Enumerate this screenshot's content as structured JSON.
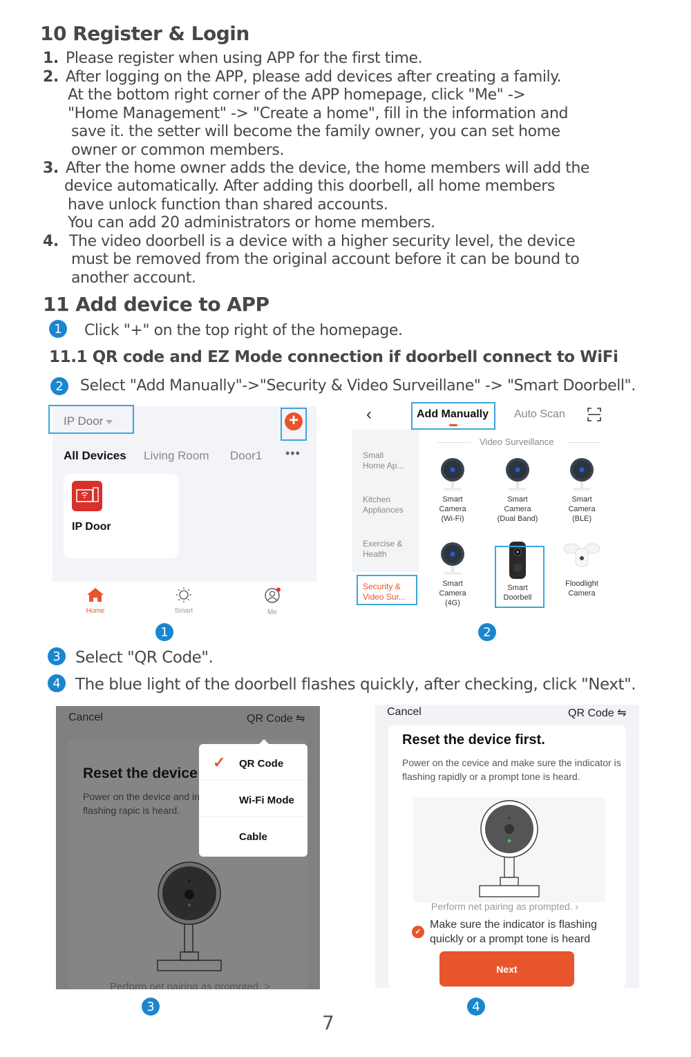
{
  "section10": {
    "title": "10  Register & Login",
    "items": [
      {
        "num": "1.",
        "lines": [
          "Please register when using  APP for the first time."
        ]
      },
      {
        "num": "2.",
        "lines": [
          "After logging on the APP, please add devices after creating a family.",
          "At the bottom right corner of the APP homepage, click \"Me\" ->",
          "\"Home Management\" -> \"Create a home\", fill in the information and",
          "save it. the setter will become the family owner, you can set home",
          "owner or common members."
        ]
      },
      {
        "num": "3.",
        "lines": [
          "After the home owner adds the device, the home members will add the",
          "device automatically. After adding this doorbell, all home members",
          "have unlock function than shared accounts.",
          "You can add 20 administrators or home members."
        ]
      },
      {
        "num": "4.",
        "lines": [
          "The video doorbell is a device with a higher security level, the device",
          "must be removed from the original account before it can be bound to",
          "another account."
        ]
      }
    ]
  },
  "section11": {
    "title": "11  Add device to APP",
    "step1": {
      "badge": "1",
      "text": "Click \"+\" on the top right of the homepage."
    },
    "sub_title": "11.1  QR code and EZ Mode connection if doorbell connect to WiFi",
    "step2": {
      "badge": "2",
      "text": "Select \"Add Manually\"->\"Security & Video Surveillane\" -> \"Smart Doorbell\"."
    },
    "step3": {
      "badge": "3",
      "text": "Select \"QR Code\"."
    },
    "step4": {
      "badge": "4",
      "text": "The blue light of the doorbell flashes quickly, after checking, click \"Next\"."
    }
  },
  "screen1": {
    "home_name": "IP Door",
    "room_tabs": [
      "All Devices",
      "Living Room",
      "Door1"
    ],
    "more": "•••",
    "device_name": "IP Door",
    "tabbar": [
      {
        "label": "Home",
        "icon": "home-icon"
      },
      {
        "label": "Smart",
        "icon": "sun-icon"
      },
      {
        "label": "Me",
        "icon": "user-icon"
      }
    ],
    "caption_badge": "1",
    "accent": "#e8542b"
  },
  "screen2": {
    "back": "‹",
    "tab_active": "Add Manually",
    "tab_other": "Auto Scan",
    "categories": [
      "Small\nHome Ap...",
      "Kitchen\nAppliances",
      "Exercise &\nHealth"
    ],
    "selected_category": "Security &\nVideo Sur...",
    "section_title": "Video Surveillance",
    "products": [
      {
        "name": "Smart\nCamera\n(Wi-Fi)",
        "icon": "camera"
      },
      {
        "name": "Smart\nCamera\n(Dual Band)",
        "icon": "camera"
      },
      {
        "name": "Smart\nCamera\n(BLE)",
        "icon": "camera"
      },
      {
        "name": "Smart\nCamera\n(4G)",
        "icon": "camera"
      },
      {
        "name": "Smart\nDoorbell",
        "icon": "doorbell"
      },
      {
        "name": "Floodlight\nCamera",
        "icon": "floodlight"
      }
    ],
    "caption_badge": "2"
  },
  "screen3": {
    "cancel": "Cancel",
    "mode": "QR Code ⇋",
    "title": "Reset the device",
    "desc": "Power on the device and indicator is flashing rapic is heard.",
    "menu": [
      {
        "label": "QR Code",
        "checked": true
      },
      {
        "label": "Wi-Fi Mode",
        "checked": false
      },
      {
        "label": "Cable",
        "checked": false
      }
    ],
    "footer": "Perform net pairing as prompted. >",
    "caption_badge": "3"
  },
  "screen4": {
    "cancel": "Cancel",
    "mode": "QR Code ⇋",
    "title": "Reset the device first.",
    "desc": "Power on the cevice and make sure the indicator is flashing rapidly or a prompt tone is heard.",
    "pair_link": "Perform net pairing as prompted.  ›",
    "confirm": "Make sure the indicator is flashing quickly or a prompt tone is heard",
    "next": "Next",
    "caption_badge": "4"
  },
  "page_number": "7"
}
